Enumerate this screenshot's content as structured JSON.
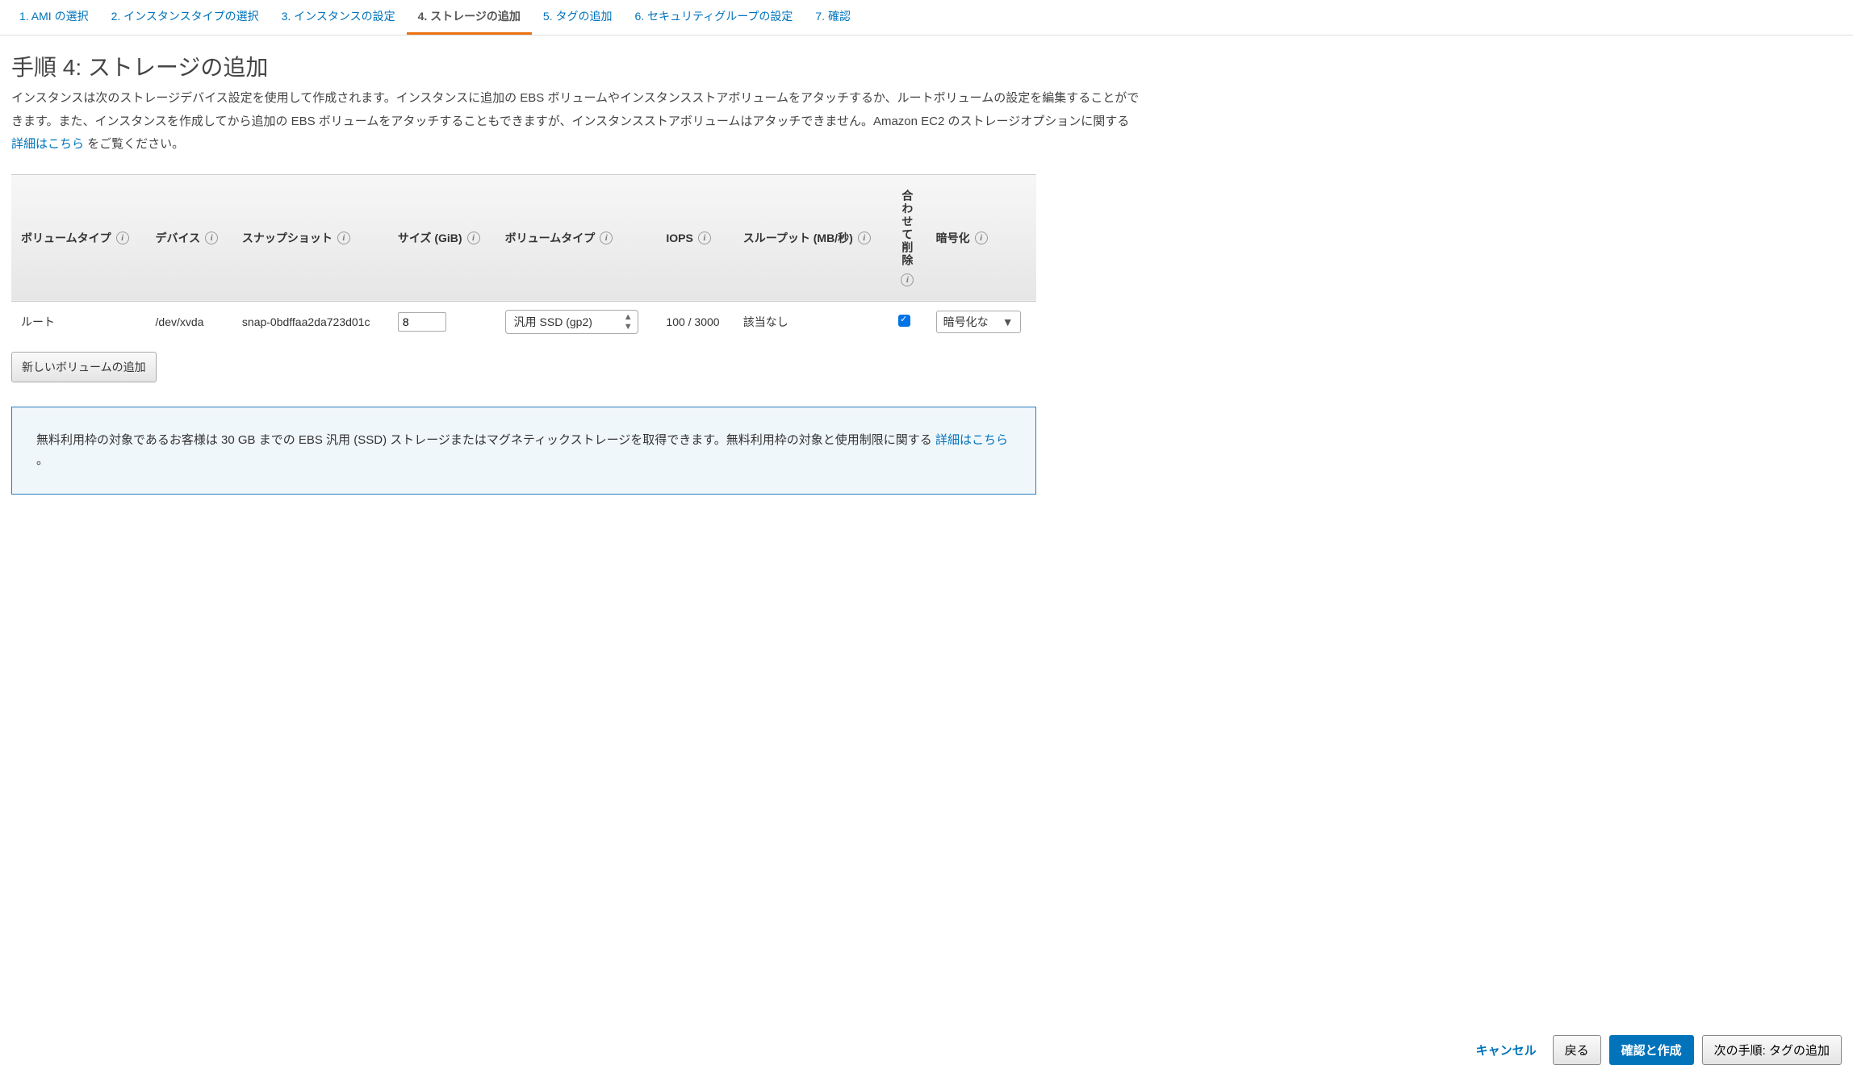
{
  "wizard": {
    "tabs": [
      "1. AMI の選択",
      "2. インスタンスタイプの選択",
      "3. インスタンスの設定",
      "4. ストレージの追加",
      "5. タグの追加",
      "6. セキュリティグループの設定",
      "7. 確認"
    ],
    "active_index": 3
  },
  "title": "手順 4: ストレージの追加",
  "description_pre": "インスタンスは次のストレージデバイス設定を使用して作成されます。インスタンスに追加の EBS ボリュームやインスタンスストアボリュームをアタッチするか、ルートボリュームの設定を編集することができます。また、インスタンスを作成してから追加の EBS ボリュームをアタッチすることもできますが、インスタンスストアボリュームはアタッチできません。Amazon EC2 のストレージオプションに関する ",
  "description_link": "詳細はこちら",
  "description_post": " をご覧ください。",
  "table": {
    "headers": {
      "vol_type_label": "ボリュームタイプ",
      "device": "デバイス",
      "snapshot": "スナップショット",
      "size": "サイズ (GiB)",
      "vol_type": "ボリュームタイプ",
      "iops": "IOPS",
      "throughput": "スループット (MB/秒)",
      "delete_on_term": "合わせて削除",
      "encryption": "暗号化"
    },
    "row": {
      "vol_type_label": "ルート",
      "device": "/dev/xvda",
      "snapshot": "snap-0bdffaa2da723d01c",
      "size": "8",
      "vol_type": "汎用 SSD (gp2)",
      "iops": "100 / 3000",
      "throughput": "該当なし",
      "delete_on_term": true,
      "encryption": "暗号化な"
    }
  },
  "add_volume_label": "新しいボリュームの追加",
  "banner_pre": "無料利用枠の対象であるお客様は 30 GB までの EBS 汎用 (SSD) ストレージまたはマグネティックストレージを取得できます。無料利用枠の対象と使用制限に関する ",
  "banner_link": "詳細はこちら",
  "banner_post": " 。",
  "footer": {
    "cancel": "キャンセル",
    "back": "戻る",
    "review": "確認と作成",
    "next": "次の手順: タグの追加"
  }
}
